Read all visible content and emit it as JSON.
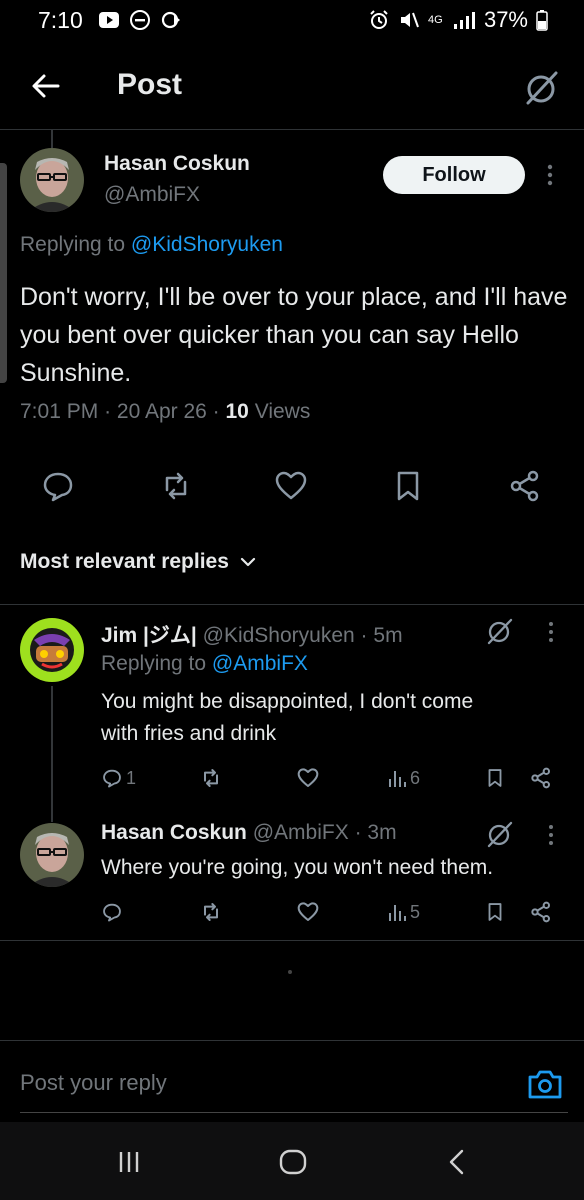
{
  "status_bar": {
    "time": "7:10",
    "network": "4G",
    "battery": "37%"
  },
  "header": {
    "title": "Post"
  },
  "main_post": {
    "author_name": "Hasan Coskun",
    "author_handle": "@AmbiFX",
    "follow_label": "Follow",
    "replying_prefix": "Replying to",
    "replying_to": "@KidShoryuken",
    "text": "Don't worry, I'll be over to your place, and I'll have you bent over quicker than you can say Hello Sunshine.",
    "time": "7:01 PM",
    "date": "20 Apr 26",
    "views_count": "10",
    "views_label": "Views",
    "separator": "·"
  },
  "sort": {
    "label": "Most relevant replies"
  },
  "replies": [
    {
      "author_name": "Jim |ジム|",
      "author_handle": "@KidShoryuken",
      "age": "5m",
      "replying_prefix": "Replying to",
      "replying_to": "@AmbiFX",
      "text_line1": "You might be disappointed, I don't come",
      "text_line2": "with fries and drink",
      "reply_count": "1",
      "views": "6"
    },
    {
      "author_name": "Hasan Coskun",
      "author_handle": "@AmbiFX",
      "age": "3m",
      "text_line1": "Where you're going, you won't need them.",
      "views": "5"
    }
  ],
  "composer": {
    "placeholder": "Post your reply"
  },
  "icons": {
    "back": "arrow-left-icon",
    "grok": "grok-icon",
    "more": "more-vertical-icon",
    "reply": "comment-icon",
    "repost": "repost-icon",
    "like": "heart-icon",
    "bookmark": "bookmark-icon",
    "share": "share-icon",
    "views": "views-chart-icon",
    "camera": "camera-icon"
  },
  "colors": {
    "background": "#000000",
    "text_primary": "#e7e9ea",
    "text_secondary": "#71767b",
    "link": "#1d9bf0",
    "follow_bg": "#eff3f4"
  }
}
